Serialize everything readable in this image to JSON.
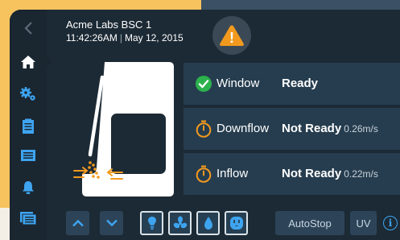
{
  "header": {
    "device_name": "Acme Labs BSC 1",
    "time": "11:42:26AM",
    "separator": "|",
    "date": "May 12, 2015"
  },
  "alert": {
    "icon": "warning-triangle-icon",
    "symbol": "!"
  },
  "sidebar": {
    "items": [
      {
        "icon": "back-chevron-icon"
      },
      {
        "icon": "home-icon",
        "active": true
      },
      {
        "icon": "settings-gears-icon"
      },
      {
        "icon": "clipboard-icon"
      },
      {
        "icon": "display-panel-icon"
      },
      {
        "icon": "alarm-bell-icon"
      },
      {
        "icon": "files-icon"
      }
    ]
  },
  "status_cards": [
    {
      "label": "Window",
      "status": "Ready",
      "value": "",
      "icon": "check-circle-icon"
    },
    {
      "label": "Downflow",
      "status": "Not Ready",
      "value": "0.26m/s",
      "icon": "timer-icon"
    },
    {
      "label": "Inflow",
      "status": "Not Ready",
      "value": "0.22m/s",
      "icon": "timer-icon"
    }
  ],
  "bottom_bar": {
    "sash_up_icon": "chevron-up-icon",
    "sash_down_icon": "chevron-down-icon",
    "toggles": [
      {
        "name": "light",
        "icon": "light-bulb-icon"
      },
      {
        "name": "fan",
        "icon": "fan-icon"
      },
      {
        "name": "gas",
        "icon": "water-drop-icon"
      },
      {
        "name": "outlet",
        "icon": "power-outlet-icon"
      }
    ],
    "autostop_label": "AutoStop",
    "uv_label": "UV",
    "info_symbol": "i"
  },
  "colors": {
    "accent_blue": "#3ea4f0",
    "ready_green": "#2bb24c",
    "warning_orange": "#f39a1e",
    "screen_bg": "#1c2a35",
    "card_bg": "#263d4f"
  }
}
